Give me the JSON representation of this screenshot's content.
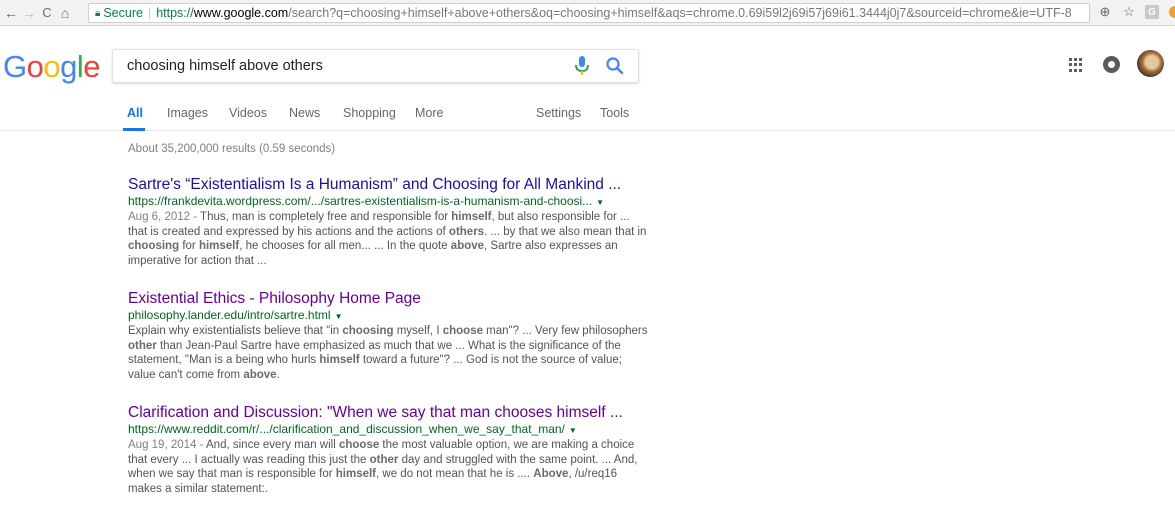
{
  "browser": {
    "secure_label": "Secure",
    "url_scheme": "https://",
    "url_host": "www.google.com",
    "url_rest": "/search?q=choosing+himself+above+others&oq=choosing+himself&aqs=chrome.0.69i59l2j69i57j69i61.3444j0j7&sourceid=chrome&ie=UTF-8"
  },
  "logo": {
    "letters": [
      "G",
      "o",
      "o",
      "g",
      "l",
      "e"
    ],
    "colors": [
      "#4285f4",
      "#ea4335",
      "#fbbc05",
      "#4285f4",
      "#34a853",
      "#ea4335"
    ]
  },
  "search": {
    "query": "choosing himself above others"
  },
  "tabs": [
    {
      "label": "All"
    },
    {
      "label": "Images"
    },
    {
      "label": "Videos"
    },
    {
      "label": "News"
    },
    {
      "label": "Shopping"
    },
    {
      "label": "More"
    },
    {
      "label": "Settings"
    },
    {
      "label": "Tools"
    }
  ],
  "stats": "About 35,200,000 results (0.59 seconds)",
  "results": [
    {
      "title": "Sartre's “Existentialism Is a Humanism” and Choosing for All Mankind ...",
      "url": "https://frankdevita.wordpress.com/.../sartres-existentialism-is-a-humanism-and-choosi...",
      "snippet_html": "<span class='r-date'>Aug 6, 2012 - </span>Thus, man is completely free and responsible for <b>himself</b>, but also responsible for ... that is created and expressed by his actions and the actions of <b>others</b>. ... by that we also mean that in <b>choosing</b> for <b>himself</b>, he chooses for all men... ... In the quote <b>above</b>, Sartre also expresses an imperative for action that ..."
    },
    {
      "title": "Existential Ethics - Philosophy Home Page",
      "url": "philosophy.lander.edu/intro/sartre.html",
      "snippet_html": "Explain why existentialists believe that \"in <b>choosing</b> myself, I <b>choose</b> man\"? ... Very few philosophers <b>other</b> than Jean-Paul Sartre have emphasized as much that we ... What is the significance of the statement, \"Man is a being who hurls <b>himself</b> toward a future\"? ... God is not the source of value; value can't come from <b>above</b>."
    },
    {
      "title": "Clarification and Discussion: \"When we say that man chooses himself ...",
      "url": "https://www.reddit.com/r/.../clarification_and_discussion_when_we_say_that_man/",
      "snippet_html": "<span class='r-date'>Aug 19, 2014 - </span>And, since every man will <b>choose</b> the most valuable option, we are making a choice that every ... I actually was reading this just the <b>other</b> day and struggled with the same point. ... And, when we say that man is responsible for <b>himself</b>, we do not mean that he is .... <b>Above</b>, /u/req16 makes a similar statement:."
    }
  ]
}
